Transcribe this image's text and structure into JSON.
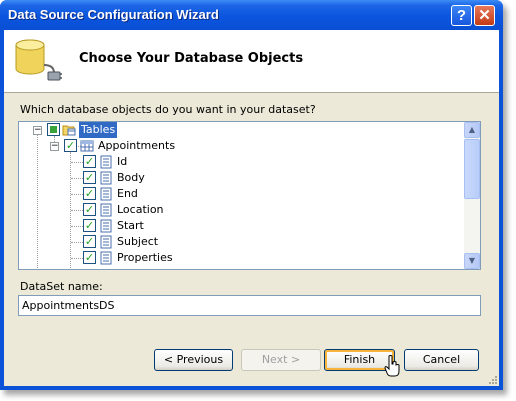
{
  "window": {
    "title": "Data Source Configuration Wizard",
    "help_glyph": "?",
    "close_glyph": "✕"
  },
  "header": {
    "title": "Choose Your Database Objects",
    "icon": "database-plug-icon"
  },
  "prompt": "Which database objects do you want in your dataset?",
  "tree": {
    "root": {
      "label": "Tables",
      "expanded": true,
      "checked": "partial",
      "selected": true
    },
    "table": {
      "label": "Appointments",
      "expanded": true,
      "checked": true
    },
    "columns": [
      {
        "label": "Id",
        "checked": true
      },
      {
        "label": "Body",
        "checked": true
      },
      {
        "label": "End",
        "checked": true
      },
      {
        "label": "Location",
        "checked": true
      },
      {
        "label": "Start",
        "checked": true
      },
      {
        "label": "Subject",
        "checked": true
      },
      {
        "label": "Properties",
        "checked": true
      }
    ]
  },
  "dataset": {
    "label": "DataSet name:",
    "value": "AppointmentsDS"
  },
  "buttons": {
    "previous": "< Previous",
    "next": "Next >",
    "finish": "Finish",
    "cancel": "Cancel"
  },
  "colors": {
    "titlebar": "#0a53d8",
    "selection": "#316ac5",
    "client": "#ece9d8"
  }
}
